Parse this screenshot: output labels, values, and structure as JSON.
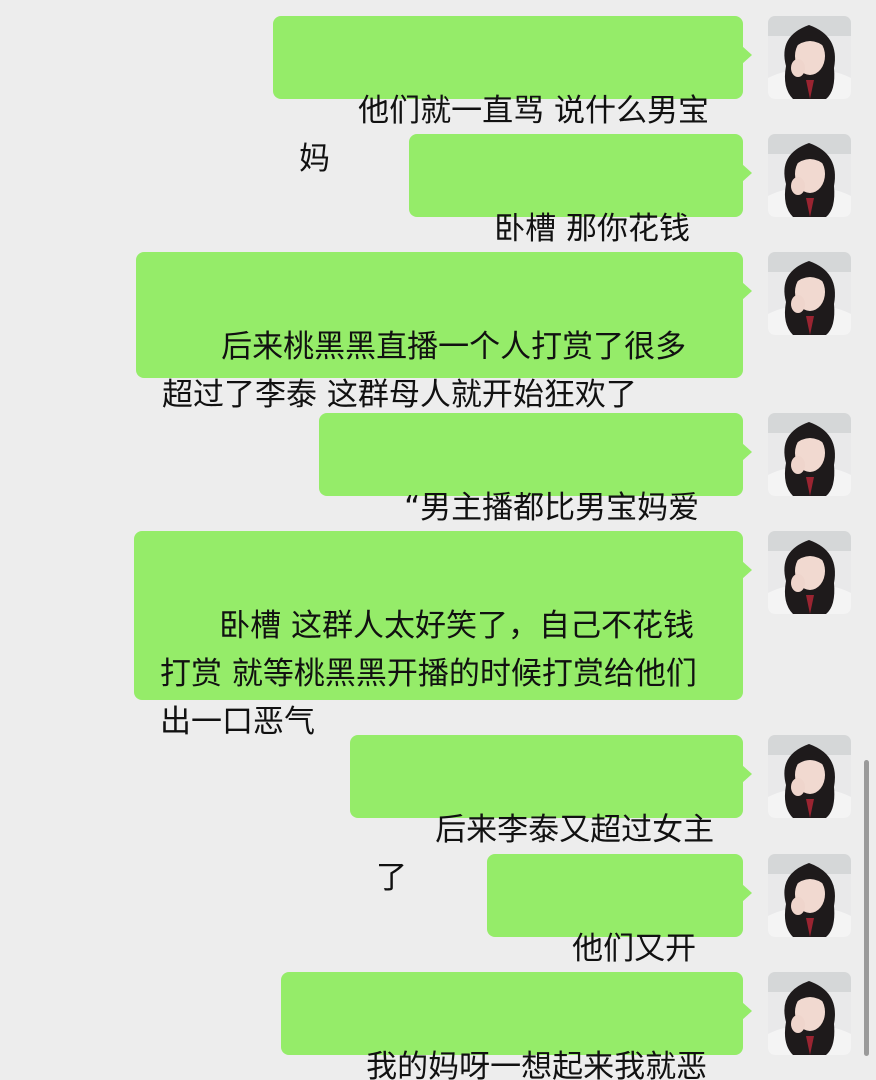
{
  "chat": {
    "messages": [
      {
        "text": "他们就一直骂 说什么男宝妈"
      },
      {
        "text": "卧槽 那你花钱投啊"
      },
      {
        "text": "后来桃黑黑直播一个人打赏了很多 超过了李泰 这群母人就开始狂欢了"
      },
      {
        "text": "“男主播都比男宝妈爱女”"
      },
      {
        "text": "卧槽 这群人太好笑了，自己不花钱打赏 就等桃黑黑开播的时候打赏给他们出一口恶气"
      },
      {
        "text": "后来李泰又超过女主了"
      },
      {
        "text": "他们又开始了"
      },
      {
        "text": "我的妈呀一想起来我就恶心"
      }
    ]
  },
  "colors": {
    "background": "#ededed",
    "bubble": "#95ec69",
    "text": "#111111"
  },
  "icons": {
    "avatar": "user-avatar-icon"
  }
}
